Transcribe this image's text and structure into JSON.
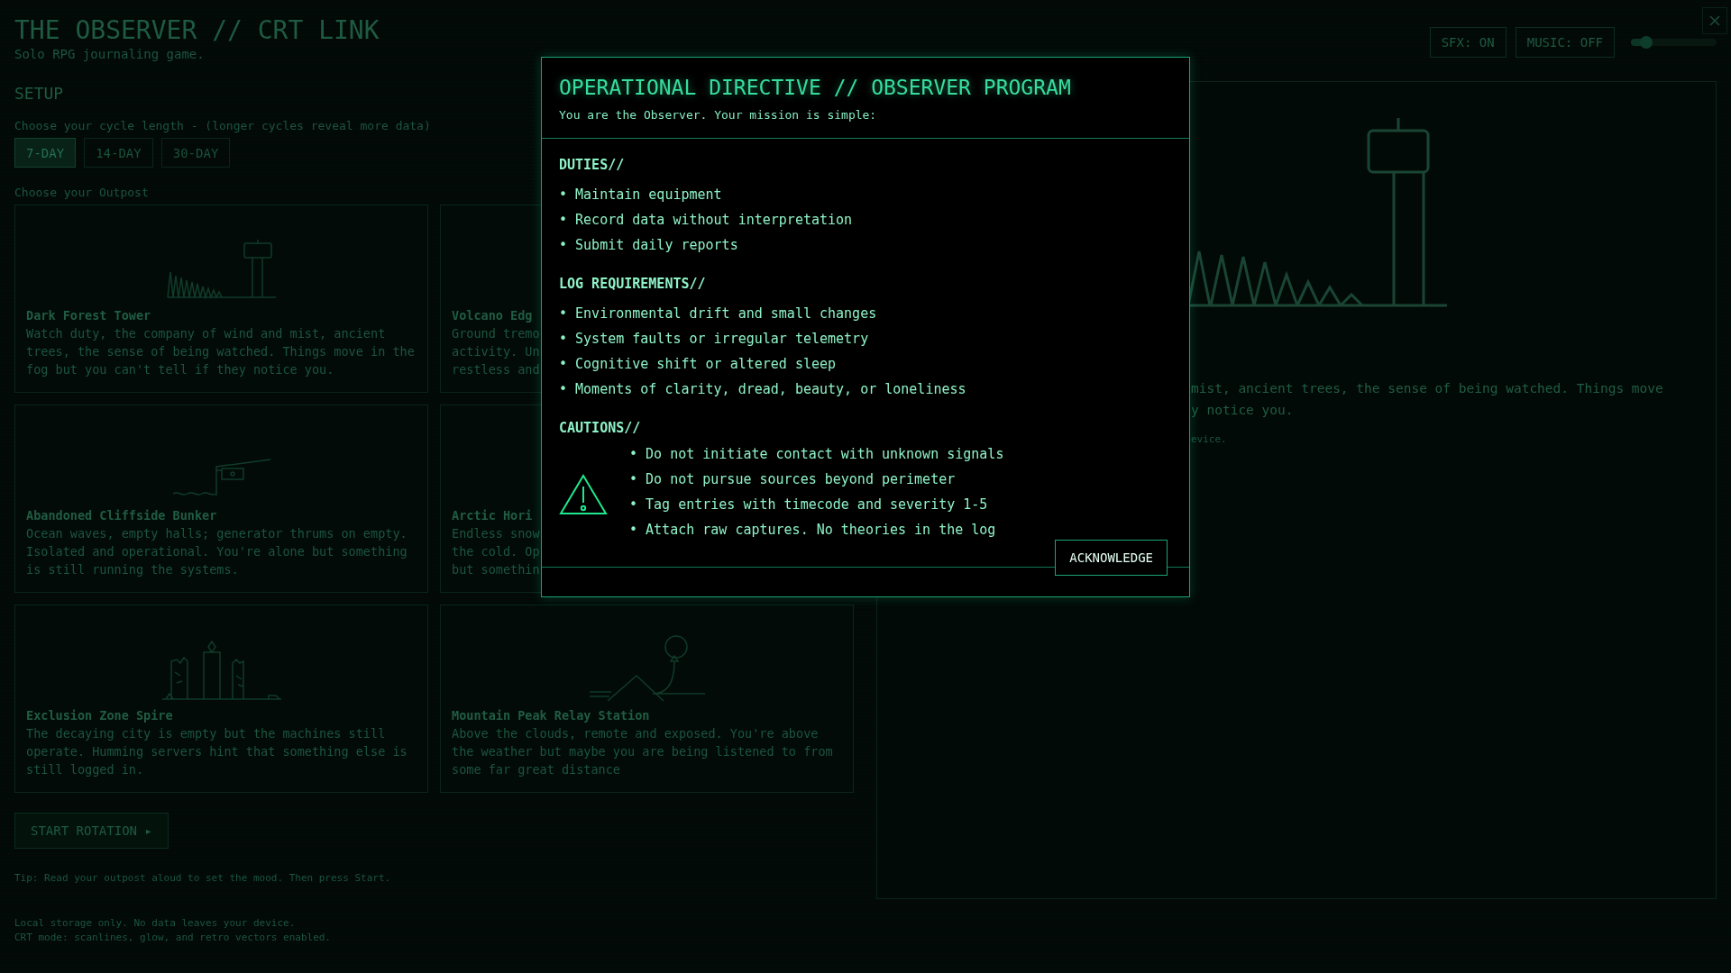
{
  "header": {
    "title": "THE OBSERVER // CRT LINK",
    "subtitle": "Solo RPG journaling game."
  },
  "audio": {
    "sfx": "SFX: ON",
    "music": "MUSIC: OFF",
    "volume": {
      "level": 0.18
    }
  },
  "setup": {
    "heading": "SETUP",
    "cycle_prompt": "Choose your cycle length - (longer cycles reveal more data)",
    "cycles": [
      {
        "label": "7-DAY",
        "selected": true
      },
      {
        "label": "14-DAY",
        "selected": false
      },
      {
        "label": "30-DAY",
        "selected": false
      }
    ],
    "outpost_prompt": "Choose your Outpost",
    "outposts": [
      {
        "title": "Dark Forest Tower",
        "lines": [
          "Watch duty, the company of wind and mist, ancient",
          "trees, the sense of being watched. Things move in the",
          "fog but you can't tell if they notice you."
        ]
      },
      {
        "title": "Volcano Edg",
        "lines": [
          "Ground tremo",
          "activity. Un",
          "restless and"
        ]
      },
      {
        "title": "Abandoned Cliffside Bunker",
        "lines": [
          "Ocean waves, empty halls; generator thrums on empty.",
          "Isolated and operational. You're alone but something",
          "is still running the systems."
        ]
      },
      {
        "title": "Arctic Hori",
        "lines": [
          "Endless snow",
          "the cold. Op",
          "but somethin"
        ]
      },
      {
        "title": "Exclusion Zone Spire",
        "lines": [
          "The decaying city is empty but the machines still",
          "operate. Humming servers hint that something else is",
          "still logged in."
        ]
      },
      {
        "title": "Mountain Peak Relay Station",
        "lines": [
          "Above the clouds, remote and exposed. You're above",
          "the weather but maybe you are being listened to from",
          "some far great distance"
        ]
      }
    ],
    "start": "START ROTATION ▸",
    "tip": "Tip: Read your outpost aloud to set the mood. Then press Start.",
    "footer": [
      "Local storage only. No data leaves your device.",
      "CRT mode: scanlines, glow, and retro vectors enabled."
    ]
  },
  "preview": {
    "lines": [
      "mist, ancient trees, the sense of being watched. Things move",
      "y notice you."
    ],
    "note": "evice."
  },
  "modal": {
    "title": "OPERATIONAL DIRECTIVE // OBSERVER PROGRAM",
    "intro": "You are the Observer. Your mission is simple:",
    "sections": [
      {
        "kind": "list",
        "heading": "DUTIES//",
        "items": [
          "• Maintain equipment",
          "• Record data without interpretation",
          "• Submit daily reports"
        ]
      },
      {
        "kind": "list",
        "heading": "LOG REQUIREMENTS//",
        "items": [
          "• Environmental drift and small changes",
          "• System faults or irregular telemetry",
          "• Cognitive shift or altered sleep",
          "• Moments of clarity, dread, beauty, or loneliness"
        ]
      },
      {
        "kind": "warning",
        "heading": "CAUTIONS//",
        "items": [
          "• Do not initiate contact with unknown signals",
          "• Do not pursue sources beyond perimeter",
          "• Tag entries with timecode and severity 1-5",
          "• Attach raw captures. No theories in the log"
        ]
      }
    ],
    "button": "ACKNOWLEDGE"
  }
}
